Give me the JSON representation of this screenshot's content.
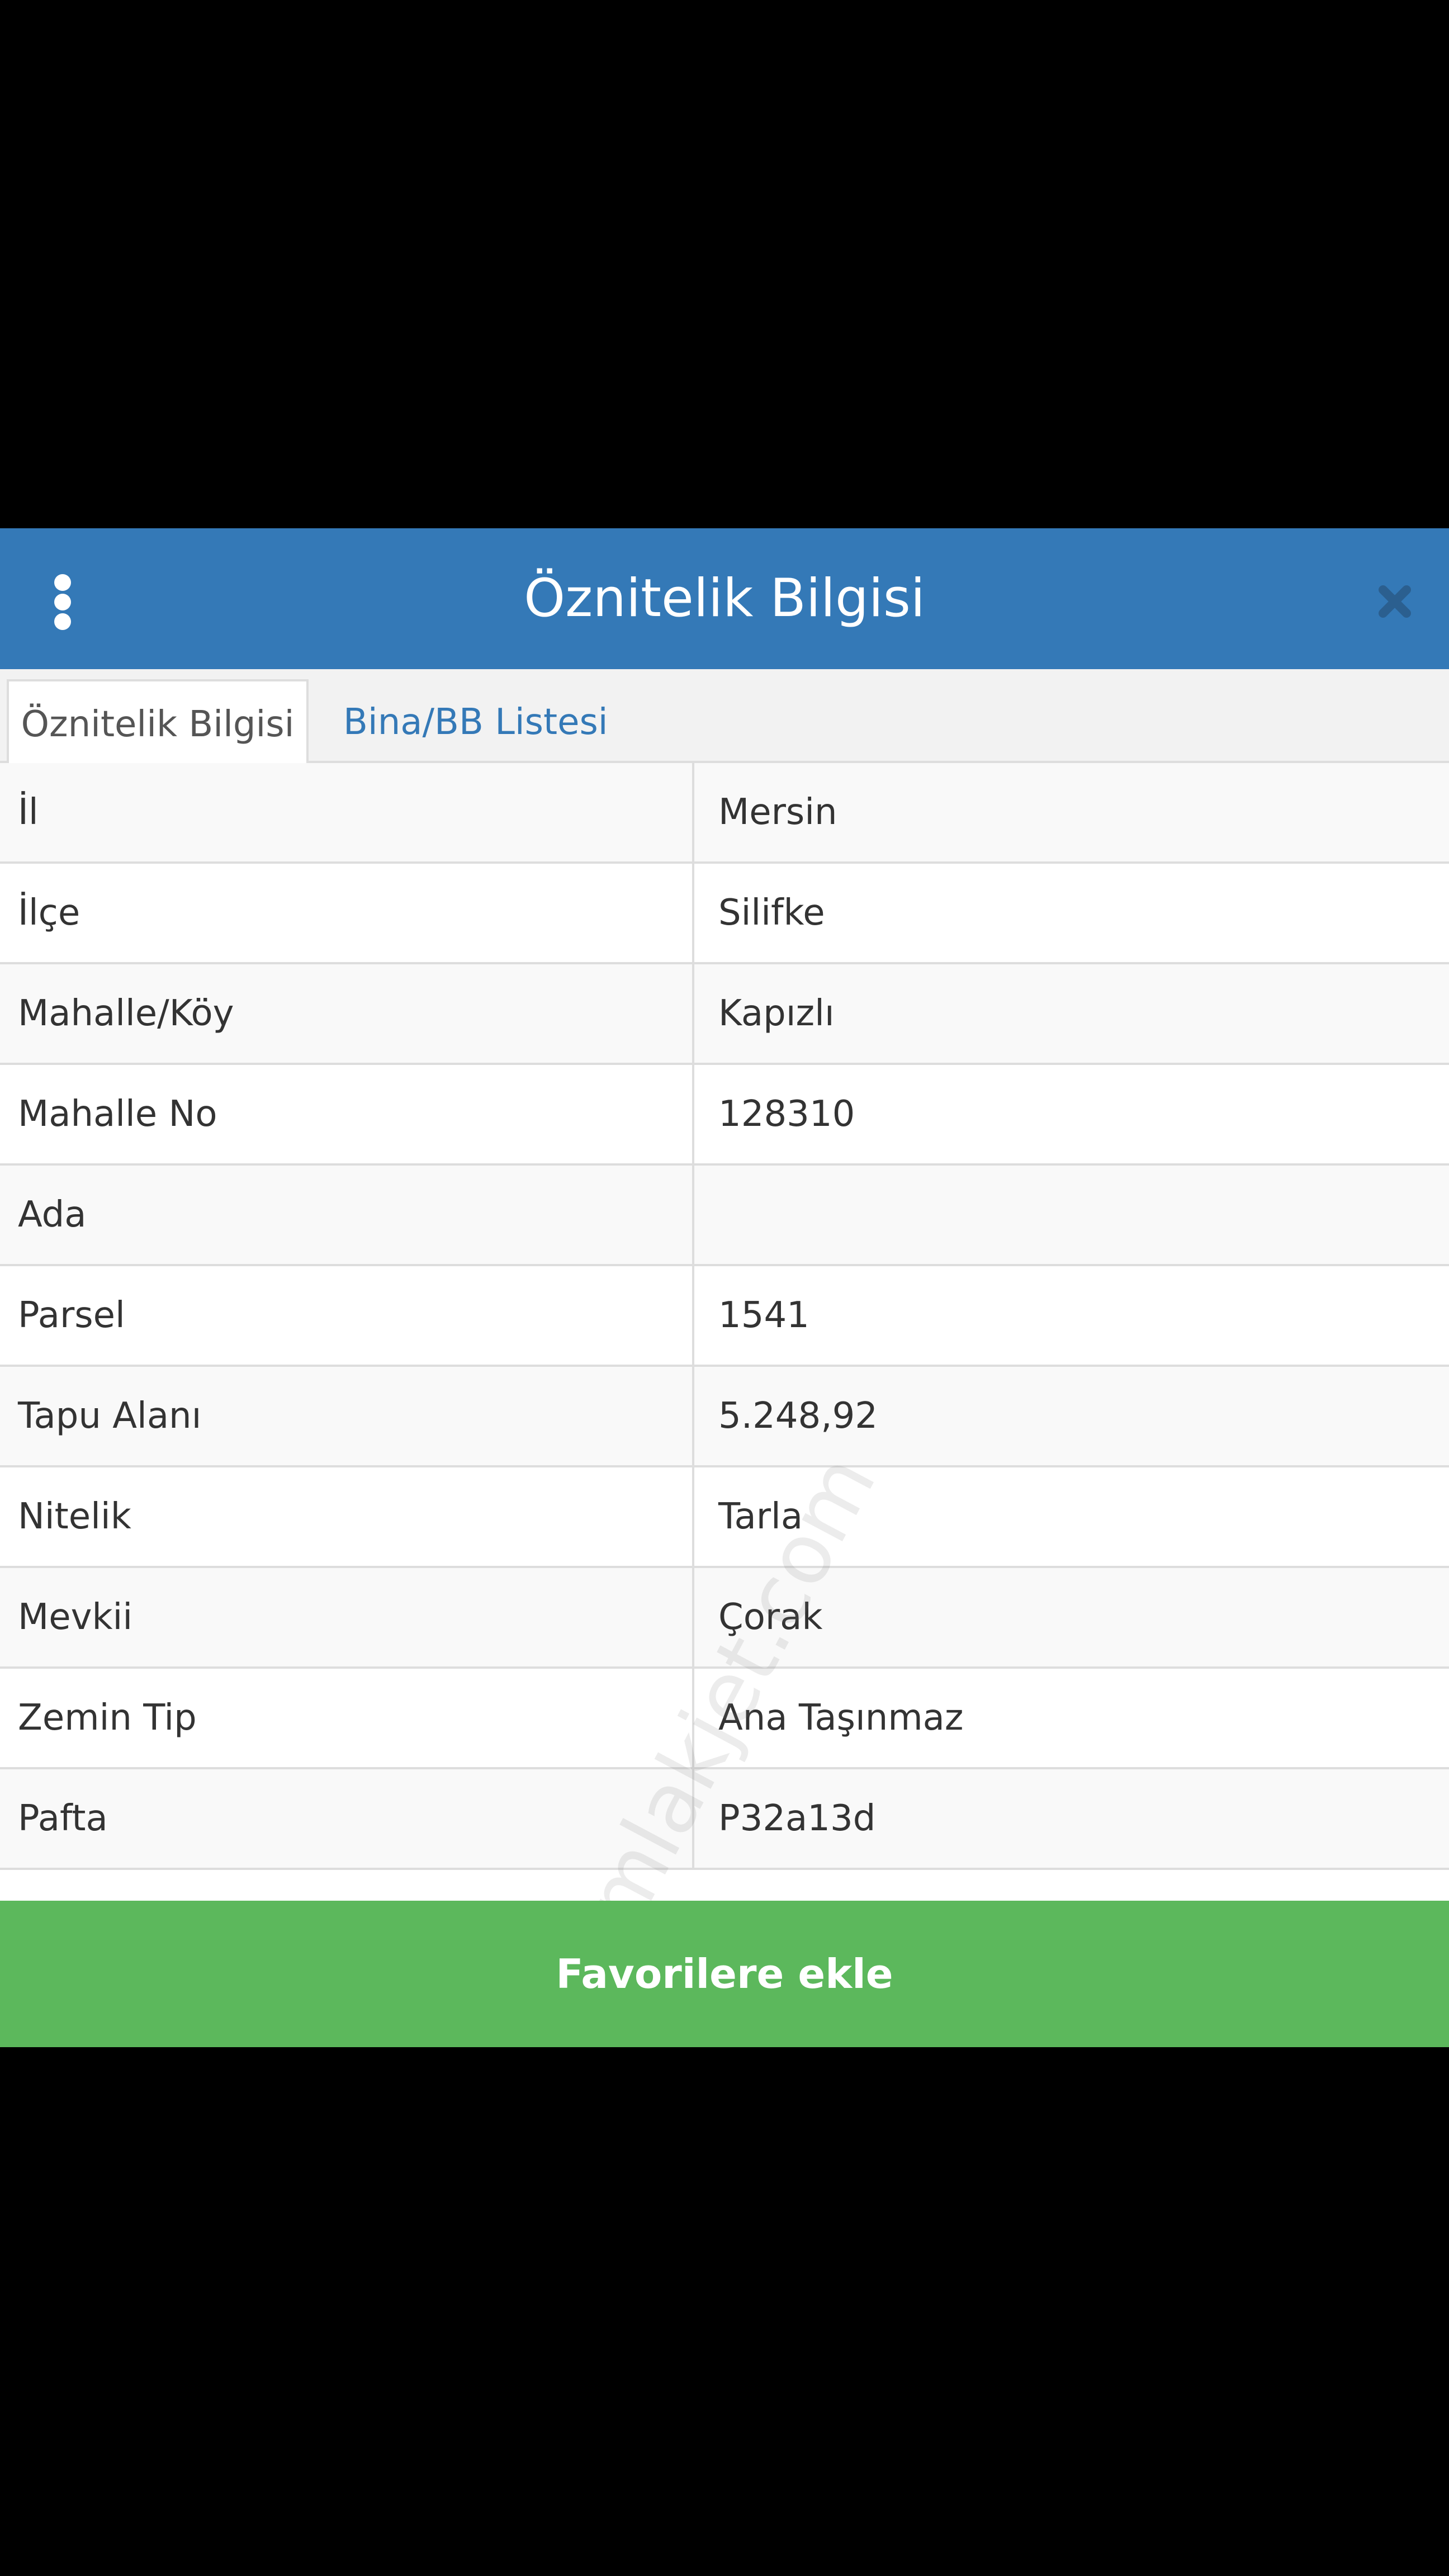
{
  "header": {
    "title": "Öznitelik Bilgisi",
    "menu_icon": "vertical-ellipsis-icon",
    "close_icon": "close-icon",
    "background_color": "#3479b7"
  },
  "tabs": [
    {
      "label": "Öznitelik Bilgisi",
      "active": true
    },
    {
      "label": "Bina/BB Listesi",
      "active": false
    }
  ],
  "attributes": [
    {
      "key": "İl",
      "value": "Mersin"
    },
    {
      "key": "İlçe",
      "value": "Silifke"
    },
    {
      "key": "Mahalle/Köy",
      "value": "Kapızlı"
    },
    {
      "key": "Mahalle No",
      "value": "128310"
    },
    {
      "key": "Ada",
      "value": ""
    },
    {
      "key": "Parsel",
      "value": "1541"
    },
    {
      "key": "Tapu Alanı",
      "value": "5.248,92"
    },
    {
      "key": "Nitelik",
      "value": "Tarla"
    },
    {
      "key": "Mevkii",
      "value": "Çorak"
    },
    {
      "key": "Zemin Tip",
      "value": "Ana Taşınmaz"
    },
    {
      "key": "Pafta",
      "value": "P32a13d"
    }
  ],
  "watermark": "emlakjet.com",
  "favorite_button": {
    "label": "Favorilere ekle",
    "color": "#5cb85c"
  }
}
